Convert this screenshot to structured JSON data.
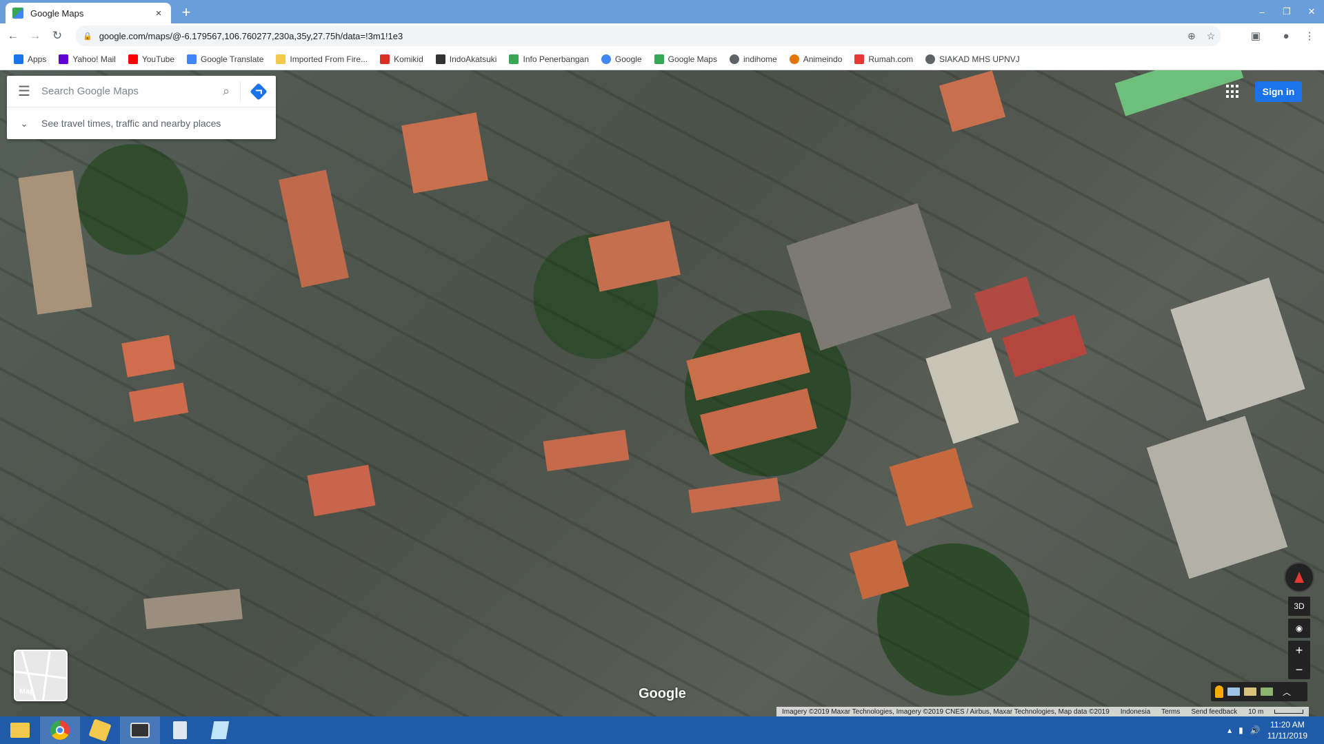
{
  "browser": {
    "tab_title": "Google Maps",
    "tab_close": "×",
    "new_tab": "+",
    "url": "google.com/maps/@-6.179567,106.760277,230a,35y,27.75h/data=!3m1!1e3",
    "window_controls": {
      "minimize": "–",
      "restore": "❐",
      "close": "✕"
    }
  },
  "bookmarks": [
    {
      "label": "Apps",
      "icon": "apps-grid-icon",
      "color": "#1a73e8"
    },
    {
      "label": "Yahoo! Mail",
      "icon": "yahoo-icon",
      "color": "#6001d2"
    },
    {
      "label": "YouTube",
      "icon": "youtube-icon",
      "color": "#ff0000"
    },
    {
      "label": "Google Translate",
      "icon": "translate-icon",
      "color": "#4285f4"
    },
    {
      "label": "Imported From Fire...",
      "icon": "folder-icon",
      "color": "#f2c94c"
    },
    {
      "label": "Komikid",
      "icon": "komikid-icon",
      "color": "#d93025"
    },
    {
      "label": "IndoAkatsuki",
      "icon": "indoakatsuki-icon",
      "color": "#333333"
    },
    {
      "label": "Info Penerbangan",
      "icon": "plane-icon",
      "color": "#34a853"
    },
    {
      "label": "Google",
      "icon": "google-icon",
      "color": "#4285f4"
    },
    {
      "label": "Google Maps",
      "icon": "maps-icon",
      "color": "#34a853"
    },
    {
      "label": "indihome",
      "icon": "globe-icon",
      "color": "#5f6368"
    },
    {
      "label": "Animeindo",
      "icon": "animeindo-icon",
      "color": "#e37400"
    },
    {
      "label": "Rumah.com",
      "icon": "rumah-icon",
      "color": "#e53935"
    },
    {
      "label": "SIAKAD MHS UPNVJ",
      "icon": "globe-icon",
      "color": "#5f6368"
    }
  ],
  "maps": {
    "search_placeholder": "Search Google Maps",
    "hint": "See travel times, traffic and nearby places",
    "sign_in": "Sign in",
    "minimap_label": "Map",
    "logo": "Google",
    "btn_3d": "3D",
    "zoom_in": "+",
    "zoom_out": "−",
    "attribution": "Imagery ©2019 Maxar Technologies, Imagery ©2019 CNES / Airbus, Maxar Technologies, Map data ©2019",
    "region": "Indonesia",
    "terms": "Terms",
    "feedback": "Send feedback",
    "scale": "10 m"
  },
  "taskbar": {
    "time": "11:20 AM",
    "date": "11/11/2019"
  }
}
